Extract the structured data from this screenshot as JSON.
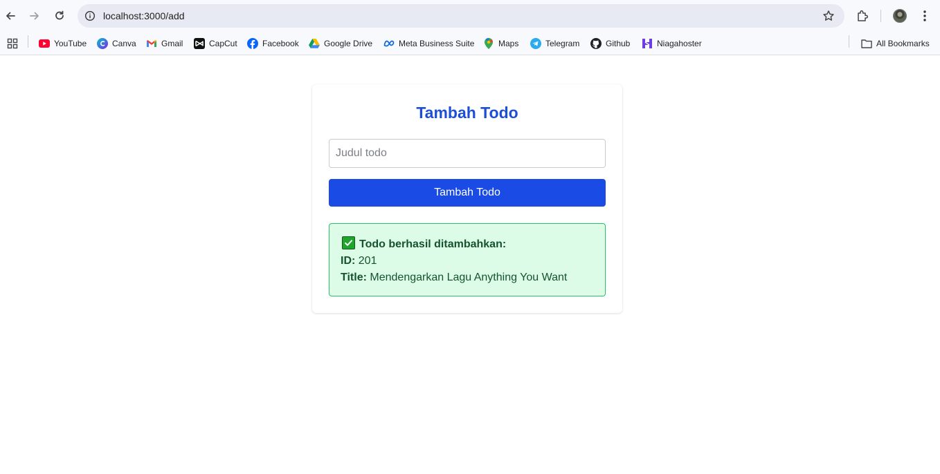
{
  "browser": {
    "url": "localhost:3000/add",
    "bookmarks": [
      {
        "label": "YouTube"
      },
      {
        "label": "Canva"
      },
      {
        "label": "Gmail"
      },
      {
        "label": "CapCut"
      },
      {
        "label": "Facebook"
      },
      {
        "label": "Google Drive"
      },
      {
        "label": "Meta Business Suite"
      },
      {
        "label": "Maps"
      },
      {
        "label": "Telegram"
      },
      {
        "label": "Github"
      },
      {
        "label": "Niagahoster"
      }
    ],
    "all_bookmarks_label": "All Bookmarks"
  },
  "page": {
    "title": "Tambah Todo",
    "input_placeholder": "Judul todo",
    "input_value": "",
    "submit_label": "Tambah Todo",
    "alert": {
      "heading": "Todo berhasil ditambahkan:",
      "id_label": "ID:",
      "id_value": "201",
      "title_label": "Title:",
      "title_value": "Mendengarkan Lagu Anything You Want"
    }
  },
  "colors": {
    "accent": "#1a4be4",
    "title": "#1d4ed8",
    "success_bg": "#dcfce7",
    "success_border": "#22c55e",
    "success_text": "#14532d"
  }
}
